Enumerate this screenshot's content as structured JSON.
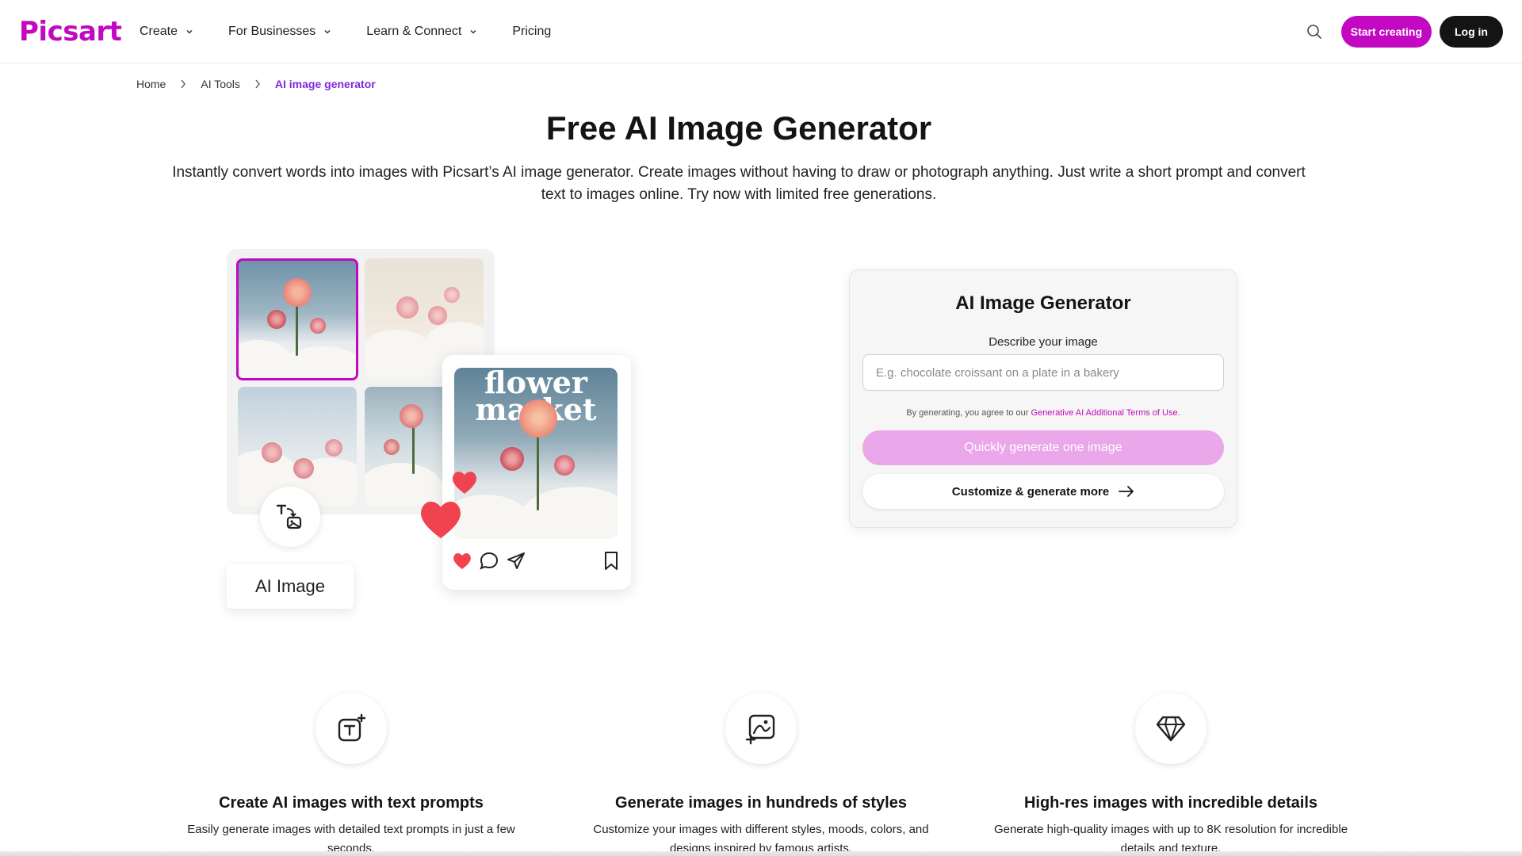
{
  "brand": {
    "logo": "Picsart",
    "accent": "#c209c1"
  },
  "nav": {
    "items": [
      {
        "label": "Create",
        "has_dropdown": true
      },
      {
        "label": "For Businesses",
        "has_dropdown": true
      },
      {
        "label": "Learn & Connect",
        "has_dropdown": true
      },
      {
        "label": "Pricing",
        "has_dropdown": false
      }
    ],
    "search_icon": "search-icon",
    "start_label": "Start creating",
    "login_label": "Log in"
  },
  "breadcrumb": {
    "home": "Home",
    "tools": "AI Tools",
    "current": "AI image generator"
  },
  "hero": {
    "title": "Free AI Image Generator",
    "subtitle": "Instantly convert words into images with Picsart’s AI image generator. Create images without having to draw or photograph anything. Just write a short prompt and convert text to images online. Try now with limited free generations."
  },
  "illustration": {
    "ai_label": "AI Image",
    "post_text_line1": "flower",
    "post_text_line2": "market"
  },
  "generator": {
    "title": "AI Image Generator",
    "input_label": "Describe your image",
    "input_placeholder": "E.g. chocolate croissant on a plate in a bakery",
    "terms_prefix": "By generating, you agree to our ",
    "terms_link": "Generative AI Additional Terms of Use",
    "terms_suffix": ".",
    "quick_label": "Quickly generate one image",
    "custom_label": "Customize & generate more"
  },
  "features": [
    {
      "icon": "text-to-image-icon",
      "title": "Create AI images with text prompts",
      "desc": "Easily generate images with detailed text prompts in just a few seconds."
    },
    {
      "icon": "image-add-icon",
      "title": "Generate images in hundreds of styles",
      "desc": "Customize your images with different styles, moods, colors, and designs inspired by famous artists."
    },
    {
      "icon": "diamond-icon",
      "title": "High-res images with incredible details",
      "desc": "Generate high-quality images with up to 8K resolution for incredible details and texture."
    }
  ]
}
